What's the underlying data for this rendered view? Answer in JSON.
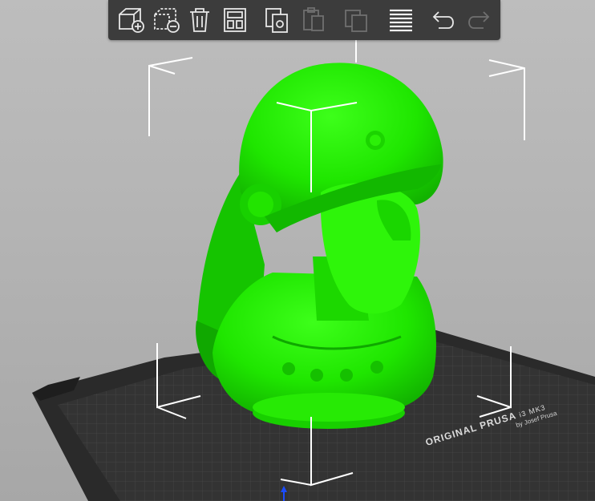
{
  "toolbar": {
    "items": [
      {
        "name": "add-button",
        "icon": "add-object-icon",
        "enabled": true
      },
      {
        "name": "delete-button",
        "icon": "remove-object-icon",
        "enabled": true
      },
      {
        "name": "delete-all-button",
        "icon": "trash-icon",
        "enabled": true
      },
      {
        "name": "arrange-button",
        "icon": "arrange-icon",
        "enabled": true
      },
      {
        "name": "copy-button",
        "icon": "copy-icon",
        "enabled": true
      },
      {
        "name": "paste-button",
        "icon": "paste-icon",
        "enabled": false
      },
      {
        "name": "add-instance-button",
        "icon": "instance-icon",
        "enabled": false
      },
      {
        "name": "layers-button",
        "icon": "layers-icon",
        "enabled": true
      },
      {
        "name": "undo-button",
        "icon": "undo-icon",
        "enabled": true
      },
      {
        "name": "redo-button",
        "icon": "redo-icon",
        "enabled": false
      }
    ]
  },
  "bed": {
    "label_main": "ORIGINAL PRUSA",
    "label_model": "i3 MK3",
    "label_sub": "by Josef Prusa"
  },
  "colors": {
    "model": "#22ee00",
    "toolbar": "#3c3c3c",
    "bed": "#2c2c2c",
    "grid": "#4e4e4e",
    "background": "#b4b4b4"
  }
}
